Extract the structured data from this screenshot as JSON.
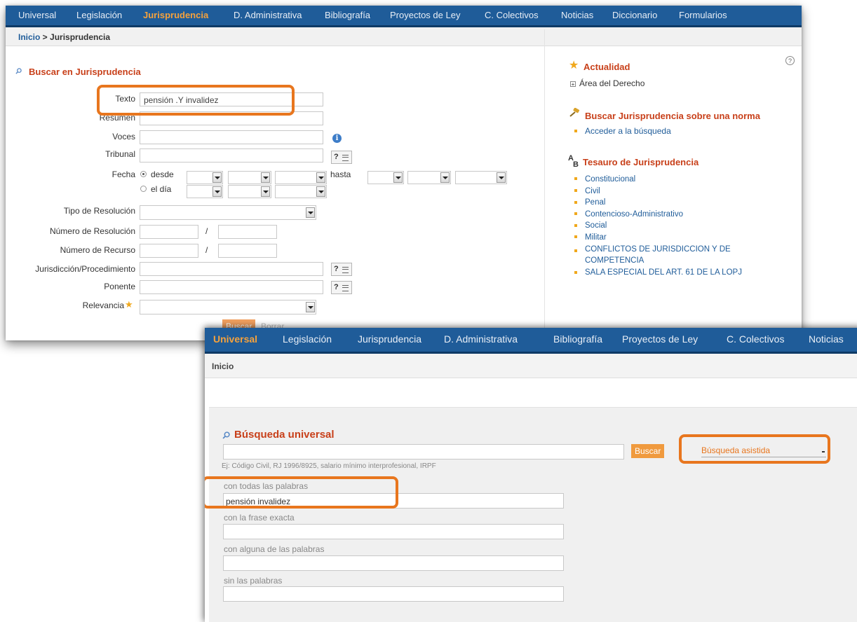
{
  "window1": {
    "nav": [
      "Universal",
      "Legislación",
      "Jurisprudencia",
      "D. Administrativa",
      "Bibliografía",
      "Proyectos de Ley",
      "C. Colectivos",
      "Noticias",
      "Diccionario",
      "Formularios"
    ],
    "active_nav": "Jurisprudencia",
    "breadcrumb": {
      "home": "Inicio",
      "separator": " > ",
      "current": "Jurisprudencia"
    },
    "search_title": "Buscar en Jurisprudencia",
    "fields": {
      "texto_label": "Texto",
      "texto_value": "pensión .Y invalidez",
      "resumen_label": "Resumen",
      "voces_label": "Voces",
      "tribunal_label": "Tribunal",
      "fecha_label": "Fecha",
      "desde_label": "desde",
      "el_dia_label": "el día",
      "hasta_label": "hasta",
      "tipo_label": "Tipo de Resolución",
      "num_res_label": "Número de Resolución",
      "num_rec_label": "Número de Recurso",
      "jurisdiccion_label": "Jurisdicción/Procedimiento",
      "ponente_label": "Ponente",
      "relevancia_label": "Relevancia",
      "slash": "/",
      "qbtn_label": "?"
    },
    "buttons": {
      "buscar": "Buscar",
      "borrar": "Borrar"
    },
    "sidebar": {
      "actualidad_title": "Actualidad",
      "area_derecho": "Área del Derecho",
      "norma_title": "Buscar Jurisprudencia sobre una norma",
      "acceder": "Acceder a la búsqueda",
      "tesauro_title": "Tesauro de Jurisprudencia",
      "tesauro_items": [
        "Constitucional",
        "Civil",
        "Penal",
        "Contencioso-Administrativo",
        "Social",
        "Militar",
        "CONFLICTOS DE JURISDICCION Y DE",
        "COMPETENCIA",
        "SALA ESPECIAL DEL ART. 61 DE LA LOPJ"
      ]
    },
    "help_icon": "?",
    "info_icon": "i",
    "icon_ab": {
      "top": "A",
      "bottom": "B"
    }
  },
  "window2": {
    "nav": [
      "Universal",
      "Legislación",
      "Jurisprudencia",
      "D. Administrativa",
      "Bibliografía",
      "Proyectos de Ley",
      "C. Colectivos",
      "Noticias"
    ],
    "active_nav": "Universal",
    "breadcrumb": "Inicio",
    "title": "Búsqueda universal",
    "search_button": "Buscar",
    "example": "Ej: Código Civil, RJ 1996/8925, salario mínimo interprofesional, IRPF",
    "mode_select": "Búsqueda asistida",
    "fields": [
      {
        "label": "con todas las palabras",
        "value": "pensión invalidez"
      },
      {
        "label": "con la frase exacta",
        "value": ""
      },
      {
        "label": "con alguna de las palabras",
        "value": ""
      },
      {
        "label": "sin las palabras",
        "value": ""
      }
    ]
  },
  "colors": {
    "nav_bg": "#1f5c99",
    "active": "#f6a23c",
    "title_red": "#c8401a",
    "highlight": "#e8761e"
  }
}
